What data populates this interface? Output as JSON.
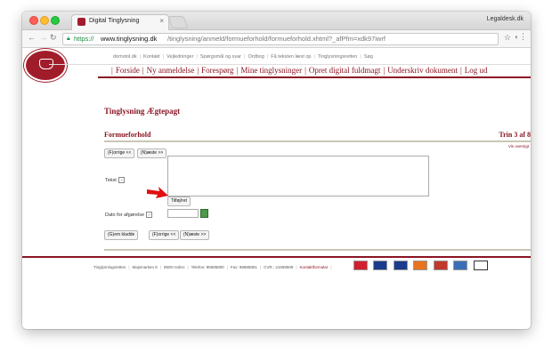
{
  "browser": {
    "tab_title": "Digital Tinglysning",
    "tab_close": "×",
    "profile_name": "Legaldesk.dk",
    "url_scheme": "https://",
    "url_host": "www.tinglysning.dk",
    "url_path": "/tinglysning/anmeld/formueforhold/formueforhold.xhtml?_afPfm=xdk97iwrf",
    "icons": {
      "back": "back-arrow-icon",
      "forward": "forward-arrow-icon",
      "reload": "reload-icon",
      "lock": "lock-icon",
      "star": "star-icon",
      "menu": "menu-icon"
    }
  },
  "site": {
    "top_links": [
      "domstol.dk",
      "Kontakt",
      "Vejledninger",
      "Spørgsmål og svar",
      "Ordbog",
      "Få teksten læst op",
      "Tinglysningsretten",
      "Søg"
    ],
    "nav": [
      "Forside",
      "Ny anmeldelse",
      "Forespørg",
      "Mine tinglysninger",
      "Opret digital fuldmagt",
      "Underskriv dokument",
      "Log ud"
    ]
  },
  "content": {
    "page_title": "Tinglysning Ægtepagt",
    "section_title": "Formueforhold",
    "step": "Trin 3 af 8",
    "help_link": "Vis oversigt",
    "prev_label": "(F)orrige <<",
    "next_label": "(N)æste >>",
    "text_label": "Tekst",
    "insert_label": "Tilføj/ret",
    "date_label": "Dato for afgørelse",
    "save_draft_label": "(G)em kladde",
    "help_glyph": "?"
  },
  "footer": {
    "items": [
      "Tinglysningsretten",
      "Majsmarken 5",
      "9500 Hobro",
      "Telefon: 99685800",
      "Fax: 99685801",
      "CVR.: 21659509"
    ],
    "contact": "Kontaktformular"
  },
  "colors": {
    "brand": "#8a1523",
    "rule": "#c9c6b5",
    "url_green": "#1e8e3e"
  }
}
